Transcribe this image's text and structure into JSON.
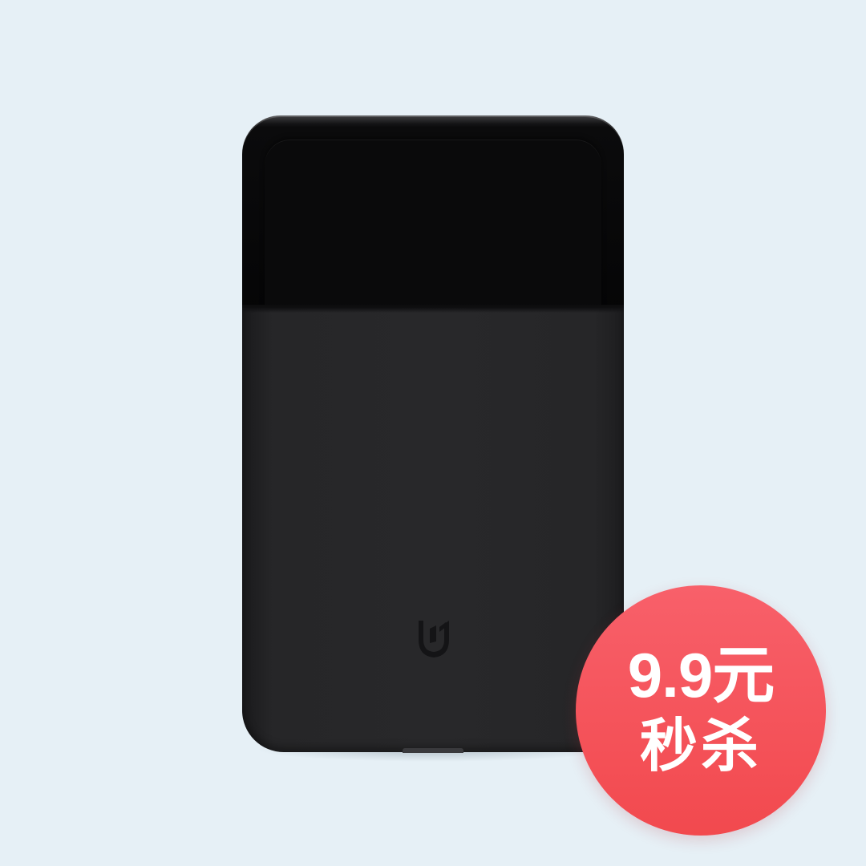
{
  "badge": {
    "price": "9.9元",
    "label": "秒杀"
  },
  "product": {
    "logo_icon": "mijia-logo-icon"
  },
  "colors": {
    "background": "#e6f0f6",
    "badge": "#f2494e",
    "badge_text": "#ffffff",
    "product": "#27272a"
  }
}
